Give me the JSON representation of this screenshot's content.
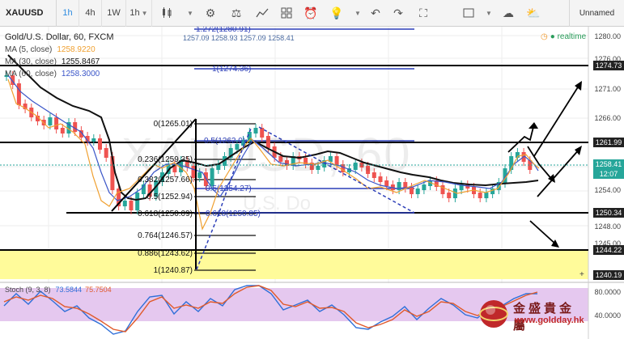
{
  "toolbar": {
    "symbol": "XAUUSD",
    "intervals": [
      "1h",
      "4h",
      "1W",
      "1h"
    ],
    "layout_name": "Unnamed"
  },
  "legend": {
    "title": "Gold/U.S. Dollar, 60, FXCM",
    "ohlc": "1257.09 1258.93 1257.09 1258.41",
    "ma5_label": "MA (5, close)",
    "ma5_value": "1258.9220",
    "ma30_label": "MA (30, close)",
    "ma30_value": "1255.8467",
    "ma60_label": "MA (60, close)",
    "ma60_value": "1258.3000",
    "realtime": "realtime"
  },
  "watermark": {
    "symbol": "XAUUSD, 60",
    "name": "U.S. Do"
  },
  "price_axis": {
    "labels": [
      "1280.00",
      "1276.00",
      "1271.00",
      "1266.00",
      "1262.00",
      "1258.00",
      "1254.00",
      "1250.00",
      "1248.00",
      "1245.00"
    ],
    "tags": {
      "r1": "1274.73",
      "r2": "1261.99",
      "current": "1258.41",
      "countdown": "12:07",
      "s1": "1250.34",
      "s2": "1244.22",
      "s3": "1240.19"
    }
  },
  "fib_levels": [
    {
      "label": "1.272(1280.91)"
    },
    {
      "label": "1(1274.36)"
    },
    {
      "label": "0(1265.01)"
    },
    {
      "label": "0.5(1262.0)"
    },
    {
      "label": "0.236(1259.35)"
    },
    {
      "label": "0.382(1257.66)"
    },
    {
      "label": "0.5(1254.27)"
    },
    {
      "label": "0.5(1252.94)"
    },
    {
      "label": "0.618(1250.09)"
    },
    {
      "label": "0.618(1250.85)"
    },
    {
      "label": "0.764(1246.57)"
    },
    {
      "label": "0.886(1243.62)"
    },
    {
      "label": "1(1240.87)"
    }
  ],
  "stochastic": {
    "label": "Stoch (9, 3, 8)",
    "k_value": "73.5844",
    "d_value": "75.7504",
    "axis": [
      "80.0000",
      "40.0000"
    ]
  },
  "brand": {
    "chinese": "金盛貴金屬",
    "url": "www.goldday.hk"
  },
  "colors": {
    "candle_up": "#26a69a",
    "candle_down": "#ef5350",
    "resistance_tag": "#222222",
    "current_tag": "#26a69a",
    "fib_blue": "#2c3eb8",
    "yellow_zone": "#fffb9a",
    "stoch_bg": "#e5c8ef"
  }
}
